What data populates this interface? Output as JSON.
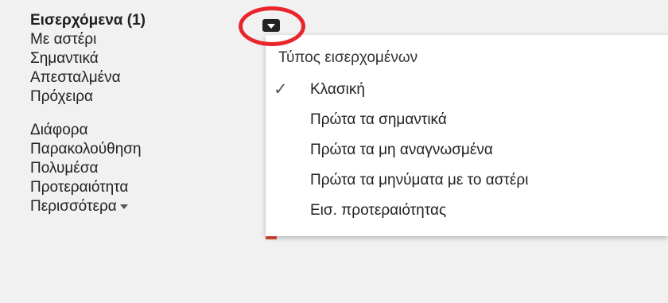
{
  "sidebar": {
    "items": [
      {
        "label": "Εισερχόμενα (1)"
      },
      {
        "label": "Με αστέρι"
      },
      {
        "label": "Σημαντικά"
      },
      {
        "label": "Απεσταλμένα"
      },
      {
        "label": "Πρόχειρα"
      },
      {
        "label": "Διάφορα"
      },
      {
        "label": "Παρακολούθηση"
      },
      {
        "label": "Πολυμέσα"
      },
      {
        "label": "Προτεραιότητα"
      },
      {
        "label": "Περισσότερα"
      }
    ]
  },
  "inbox_type_menu": {
    "trigger_icon": "dropdown-arrow-icon",
    "header": "Τύπος εισερχομένων",
    "check_glyph": "✓",
    "options": [
      {
        "label": "Κλασική",
        "selected": true
      },
      {
        "label": "Πρώτα τα σημαντικά",
        "selected": false
      },
      {
        "label": "Πρώτα τα μη αναγνωσμένα",
        "selected": false
      },
      {
        "label": "Πρώτα τα μηνύματα με το αστέρι",
        "selected": false
      },
      {
        "label": "Εισ. προτεραιότητας",
        "selected": false
      }
    ]
  },
  "colors": {
    "highlight_ring": "#e8262a",
    "accent": "#dd4b39",
    "background": "#f1f1f1",
    "menu_background": "#ffffff"
  }
}
